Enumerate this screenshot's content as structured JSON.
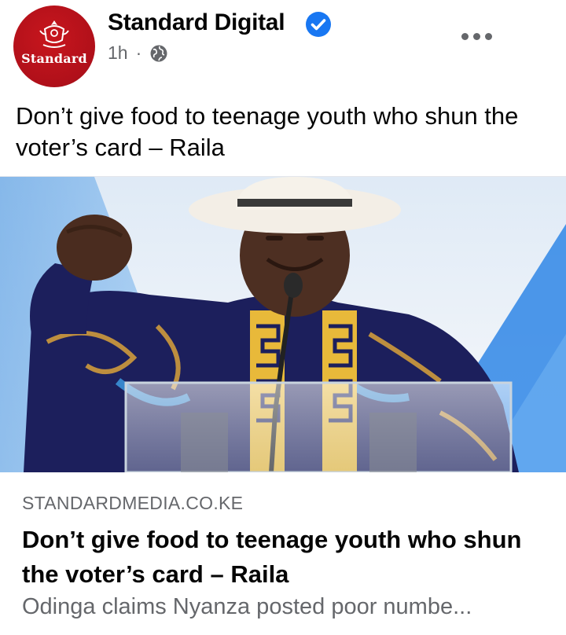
{
  "post": {
    "page_name": "Standard Digital",
    "avatar_brand": "Standard",
    "time": "1h",
    "separator": "·",
    "text": "Don’t give food to teenage youth who shun the voter’s card – Raila"
  },
  "link_card": {
    "domain": "STANDARDMEDIA.CO.KE",
    "headline": "Don’t give food to teenage youth who shun the voter’s card – Raila",
    "description": "Odinga claims Nyanza posted poor numbe..."
  },
  "icons": {
    "verified": "verified-badge-icon",
    "audience": "globe-icon",
    "more": "more-options-icon"
  },
  "colors": {
    "verified_blue": "#1877f2",
    "secondary_text": "#65676b",
    "avatar_red": "#c8161d"
  }
}
